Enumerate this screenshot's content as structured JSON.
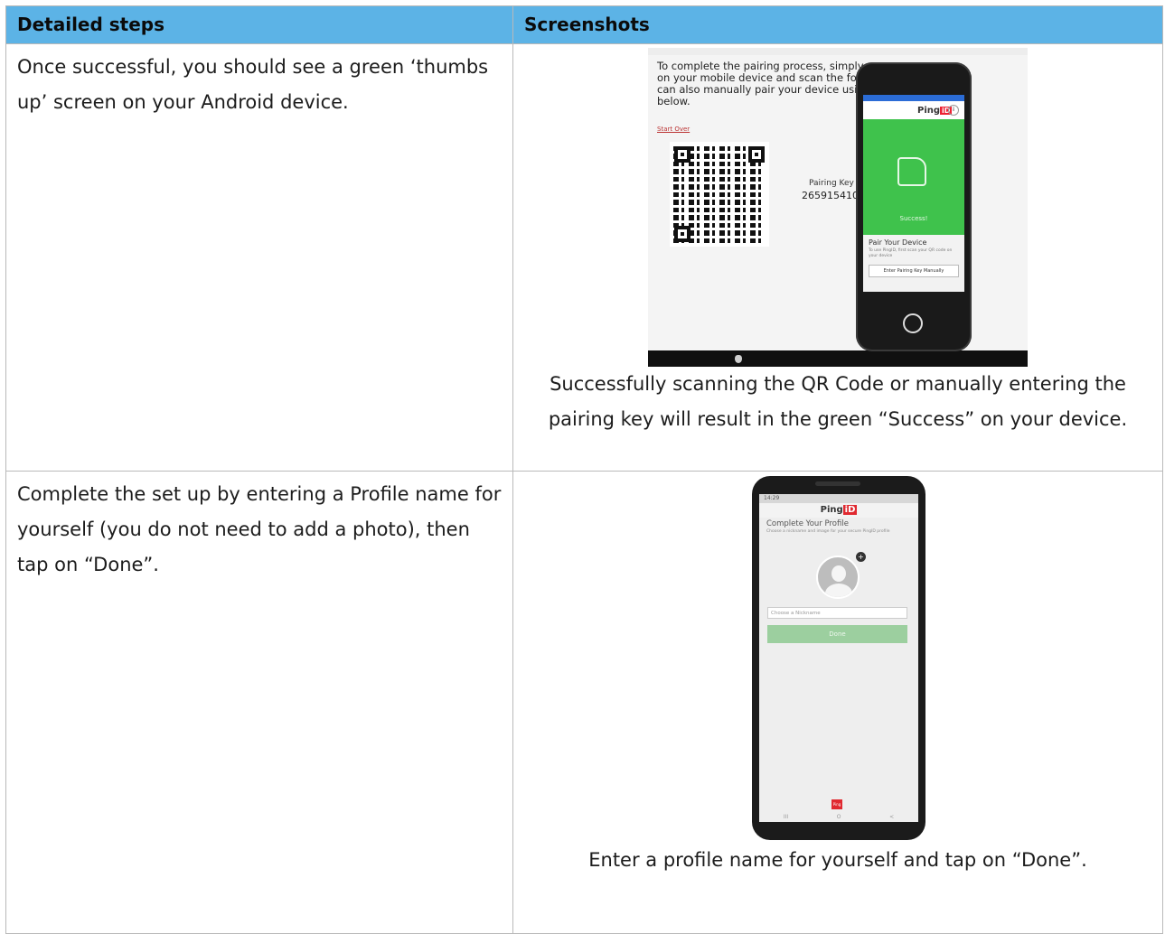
{
  "table": {
    "headers": [
      "Detailed steps",
      "Screenshots"
    ],
    "rows": [
      {
        "step": "Once successful, you should see a green ‘thumbs up’ screen on your Android device.",
        "caption": "Successfully scanning the QR Code or manually entering the pairing key will result in the green “Success” on your device."
      },
      {
        "step": "Complete the set up by entering a Profile name for yourself (you do not need to add a photo), then tap on “Done”.",
        "caption": "Enter a profile name for yourself and tap on “Done”."
      }
    ]
  },
  "screenshot1": {
    "monitor_lines": "To complete the pairing process, simply op on your mobile device and scan the followi can also manually pair your device using th below.",
    "start_over": "Start Over",
    "pairing_key_label": "Pairing Key",
    "pairing_key": "2659154107",
    "app_logo": "Ping",
    "app_logo_badge": "iD",
    "success": "Success!",
    "pair_title": "Pair Your Device",
    "pair_sub": "To use PingID, first scan your QR code on your device",
    "manual_button": "Enter Pairing Key Manually"
  },
  "screenshot2": {
    "status": "14:29",
    "app_logo": "Ping",
    "app_logo_badge": "iD",
    "heading": "Complete Your Profile",
    "sub": "Choose a nickname and image for your secure PingID profile",
    "nickname_placeholder": "Choose a Nickname",
    "done": "Done",
    "footer_logo": "Ping",
    "nav": [
      "III",
      "O",
      "<"
    ]
  },
  "colors": {
    "header_bg": "#5cb3e6",
    "success_green": "#3fc24c",
    "done_green": "#9ccf9f",
    "ping_red": "#e02930"
  }
}
